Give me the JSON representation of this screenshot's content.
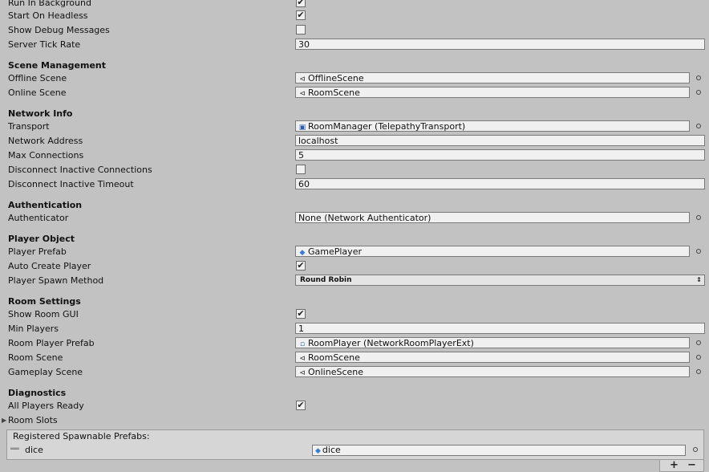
{
  "general": {
    "run_in_background": "Run In Background",
    "start_on_headless": "Start On Headless",
    "show_debug_messages": "Show Debug Messages",
    "server_tick_rate": "Server Tick Rate",
    "server_tick_rate_value": "30"
  },
  "scene_management": {
    "header": "Scene Management",
    "offline_scene": "Offline Scene",
    "offline_scene_value": "OfflineScene",
    "online_scene": "Online Scene",
    "online_scene_value": "RoomScene"
  },
  "network_info": {
    "header": "Network Info",
    "transport": "Transport",
    "transport_value": "RoomManager (TelepathyTransport)",
    "network_address": "Network Address",
    "network_address_value": "localhost",
    "max_connections": "Max Connections",
    "max_connections_value": "5",
    "disconnect_inactive": "Disconnect Inactive Connections",
    "disconnect_timeout": "Disconnect Inactive Timeout",
    "disconnect_timeout_value": "60"
  },
  "authentication": {
    "header": "Authentication",
    "authenticator": "Authenticator",
    "authenticator_value": "None (Network Authenticator)"
  },
  "player_object": {
    "header": "Player Object",
    "player_prefab": "Player Prefab",
    "player_prefab_value": "GamePlayer",
    "auto_create_player": "Auto Create Player",
    "player_spawn_method": "Player Spawn Method",
    "player_spawn_method_value": "Round Robin"
  },
  "room_settings": {
    "header": "Room Settings",
    "show_room_gui": "Show Room GUI",
    "min_players": "Min Players",
    "min_players_value": "1",
    "room_player_prefab": "Room Player Prefab",
    "room_player_prefab_value": "RoomPlayer (NetworkRoomPlayerExt)",
    "room_scene": "Room Scene",
    "room_scene_value": "RoomScene",
    "gameplay_scene": "Gameplay Scene",
    "gameplay_scene_value": "OnlineScene"
  },
  "diagnostics": {
    "header": "Diagnostics",
    "all_players_ready": "All Players Ready",
    "room_slots": "Room Slots"
  },
  "spawnable": {
    "header": "Registered Spawnable Prefabs:",
    "item_name": "dice",
    "item_value": "dice",
    "add": "+",
    "remove": "−"
  },
  "icons": {
    "checkbox": "✔",
    "scene": "⊲",
    "component": "▣",
    "prefab": "◆",
    "script": "▫"
  }
}
